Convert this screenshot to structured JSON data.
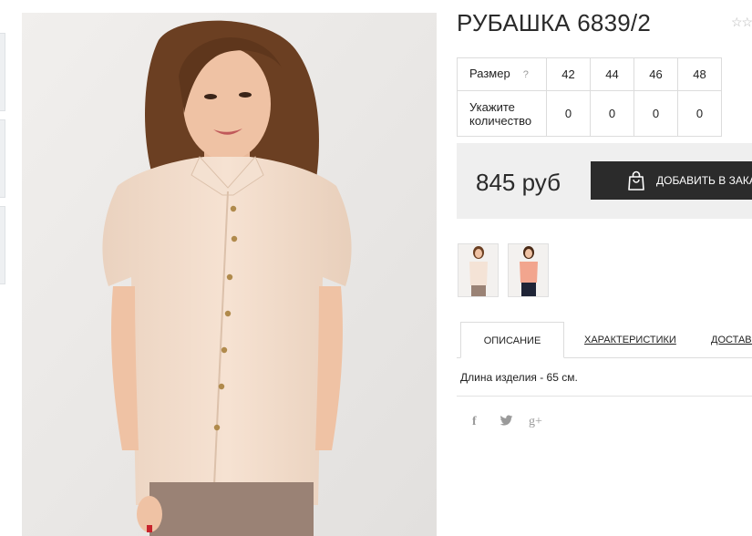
{
  "product": {
    "title": "РУБАШКА 6839/2",
    "rating_icon": "star-outline-icon",
    "rating_glyphs": "☆☆"
  },
  "size_table": {
    "size_label": "Размер",
    "help_glyph": "?",
    "sizes": [
      "42",
      "44",
      "46",
      "48"
    ],
    "qty_label": "Укажите количество",
    "quantities": [
      "0",
      "0",
      "0",
      "0"
    ]
  },
  "price": {
    "value": "845 руб",
    "add_to_cart_label": "ДОБАВИТЬ В ЗАКАЗ",
    "cart_icon": "shopping-bag-icon"
  },
  "tabs": {
    "items": [
      "ОПИСАНИЕ",
      "ХАРАКТЕРИСТИКИ",
      "ДОСТАВКА"
    ],
    "active": "ОПИСАНИЕ"
  },
  "description": "Длина изделия - 65 см.",
  "social": {
    "facebook": "f",
    "twitter": "🐦",
    "googleplus": "g+"
  },
  "colors": {
    "button_bg": "#2b2b2b",
    "price_block_bg": "#efefef",
    "blouse": "#f2dccb"
  }
}
